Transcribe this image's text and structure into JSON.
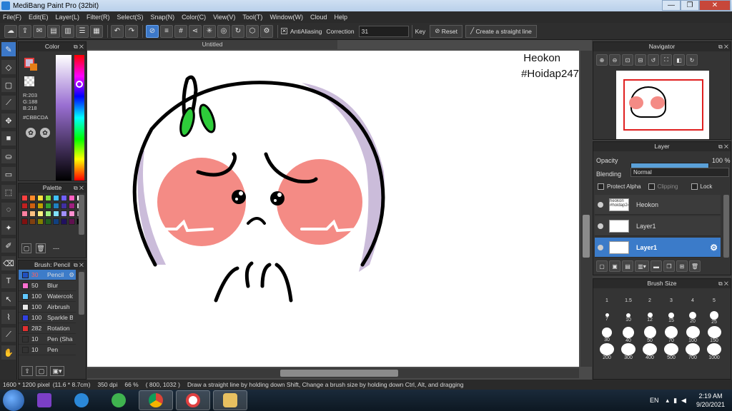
{
  "window": {
    "title": "MediBang Paint Pro (32bit)",
    "minimize": "—",
    "restore": "❐",
    "close": "✕"
  },
  "menu": [
    "File(F)",
    "Edit(E)",
    "Layer(L)",
    "Filter(R)",
    "Select(S)",
    "Snap(N)",
    "Color(C)",
    "View(V)",
    "Tool(T)",
    "Window(W)",
    "Cloud",
    "Help"
  ],
  "toolbar": {
    "antialiasing_label": "AntiAliasing",
    "correction_label": "Correction",
    "correction_value": "31",
    "key_label": "Key",
    "reset_label": "Reset",
    "straight_line_label": "Create a straight line"
  },
  "color_panel": {
    "title": "Color",
    "r": "R:203",
    "g": "G:188",
    "b": "B:218",
    "hex": "#CBBCDA",
    "fg_color": "#cbbcda",
    "bg_color": "#e47e16"
  },
  "palette_panel": {
    "title": "Palette",
    "colors": [
      "#ff4040",
      "#ff8a2a",
      "#ffe040",
      "#80e040",
      "#40c0ff",
      "#7060ff",
      "#ff60c0",
      "#ffffff",
      "#c02020",
      "#d06010",
      "#c0a000",
      "#30a030",
      "#2080c0",
      "#4030a0",
      "#a02080",
      "#d0d0d0",
      "#ff80a0",
      "#ffc080",
      "#fff080",
      "#a0f080",
      "#80e0ff",
      "#a090ff",
      "#ff90d0",
      "#909090",
      "#801010",
      "#804010",
      "#808000",
      "#206020",
      "#104080",
      "#201060",
      "#601050",
      "#000000"
    ],
    "footer": "---"
  },
  "brush_panel": {
    "title": "Brush: Pencil",
    "items": [
      {
        "size": "30",
        "name": "Pencil",
        "color": "#2050c0"
      },
      {
        "size": "50",
        "name": "Blur",
        "color": "#ff70d0"
      },
      {
        "size": "100",
        "name": "Watercolor",
        "color": "#60c8ff"
      },
      {
        "size": "100",
        "name": "Airbrush",
        "color": "#e8e8e8"
      },
      {
        "size": "100",
        "name": "Sparkle B",
        "color": "#3040e0"
      },
      {
        "size": "282",
        "name": "Rotation",
        "color": "#e03030"
      },
      {
        "size": "10",
        "name": "Pen (Sha",
        "color": "#333333"
      },
      {
        "size": "10",
        "name": "Pen",
        "color": "#333333"
      }
    ]
  },
  "canvas": {
    "tab": "Untitled",
    "text_line1": "Heokon",
    "text_line2": "#Hoidap247"
  },
  "navigator": {
    "title": "Navigator"
  },
  "layer_panel": {
    "title": "Layer",
    "opacity_label": "Opacity",
    "opacity_value": "100 %",
    "opacity_fraction": 1.0,
    "blending_label": "Blending",
    "blending_value": "Normal",
    "protect_alpha": "Protect Alpha",
    "clipping": "Clipping",
    "lock": "Lock",
    "layers": [
      {
        "name": "Heokon",
        "thumb": "heokon #hoidap247"
      },
      {
        "name": "Layer1",
        "thumb": ""
      },
      {
        "name": "Layer1",
        "thumb": ""
      }
    ]
  },
  "brush_size_panel": {
    "title": "Brush Size",
    "sizes": [
      "1",
      "1.5",
      "2",
      "3",
      "4",
      "5",
      "7",
      "10",
      "12",
      "15",
      "20",
      "25",
      "30",
      "40",
      "50",
      "70",
      "100",
      "150",
      "200",
      "300",
      "400",
      "500",
      "700",
      "1000"
    ]
  },
  "status": {
    "dimensions": "1600 * 1200 pixel",
    "physical": "(11.6 * 8.7cm)",
    "dpi": "350 dpi",
    "zoom": "66 %",
    "coords": "( 800, 1032 )",
    "hint": "Draw a straight line by holding down Shift, Change a brush size by holding down Ctrl, Alt, and dragging"
  },
  "taskbar": {
    "lang": "EN",
    "time": "2:19 AM",
    "date": "9/20/2021"
  }
}
